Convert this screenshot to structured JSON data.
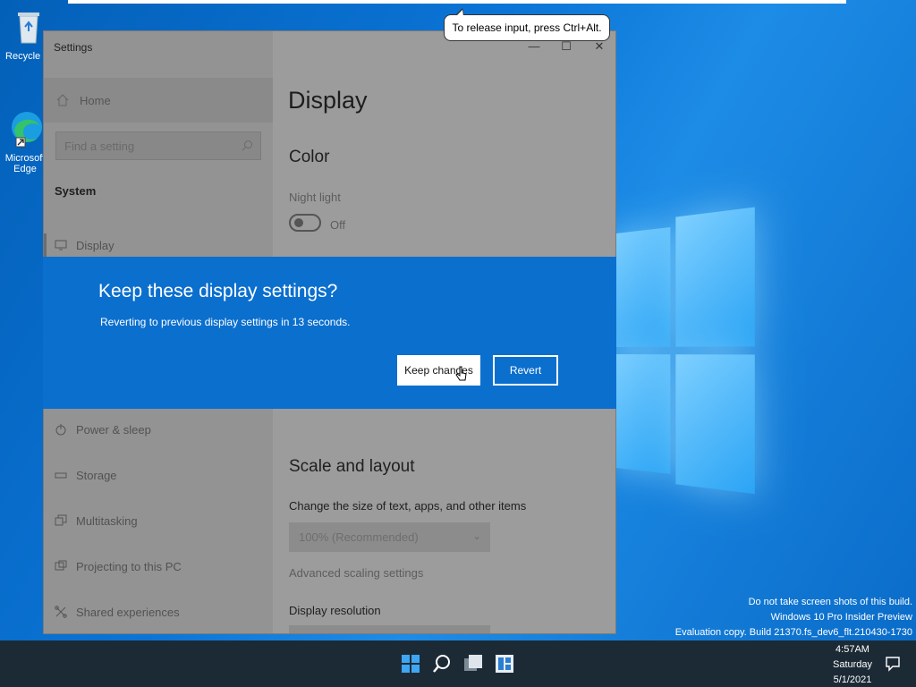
{
  "desktop": {
    "icons": [
      {
        "label": "Recycle Bi",
        "icon": "recycle-bin-icon"
      },
      {
        "label": "Microsoft Edge",
        "label_lines": [
          "Microsoft",
          "Edge"
        ],
        "icon": "edge-icon"
      }
    ],
    "tooltip": "To release input, press Ctrl+Alt.",
    "watermark": {
      "line1": "Do not take screen shots of this build.",
      "line2": "Windows 10 Pro Insider Preview",
      "line3": "Evaluation copy. Build 21370.fs_dev6_flt.210430-1730"
    }
  },
  "settings": {
    "window_title": "Settings",
    "controls": {
      "minimize": "—",
      "maximize": "☐",
      "close": "✕"
    },
    "sidebar": {
      "home_label": "Home",
      "search_placeholder": "Find a setting",
      "section_label": "System",
      "items": [
        {
          "label": "Display",
          "icon": "monitor-icon"
        },
        {
          "label": "Power & sleep",
          "icon": "power-icon"
        },
        {
          "label": "Storage",
          "icon": "storage-icon"
        },
        {
          "label": "Multitasking",
          "icon": "multitasking-icon"
        },
        {
          "label": "Projecting to this PC",
          "icon": "projecting-icon"
        },
        {
          "label": "Shared experiences",
          "icon": "shared-experiences-icon"
        }
      ]
    },
    "content": {
      "title": "Display",
      "color_heading": "Color",
      "night_light_label": "Night light",
      "night_light_state": "Off",
      "scale_heading": "Scale and layout",
      "scale_label": "Change the size of text, apps, and other items",
      "scale_value": "100% (Recommended)",
      "advanced_link": "Advanced scaling settings",
      "resolution_label": "Display resolution"
    }
  },
  "dialog": {
    "title": "Keep these display settings?",
    "message": "Reverting to previous display settings in 13 seconds.",
    "keep_label": "Keep changes",
    "revert_label": "Revert"
  },
  "taskbar": {
    "icons": [
      "start-icon",
      "search-icon",
      "task-view-icon",
      "widgets-icon"
    ],
    "clock": {
      "time": "4:57AM",
      "day": "Saturday",
      "date": "5/1/2021"
    }
  }
}
